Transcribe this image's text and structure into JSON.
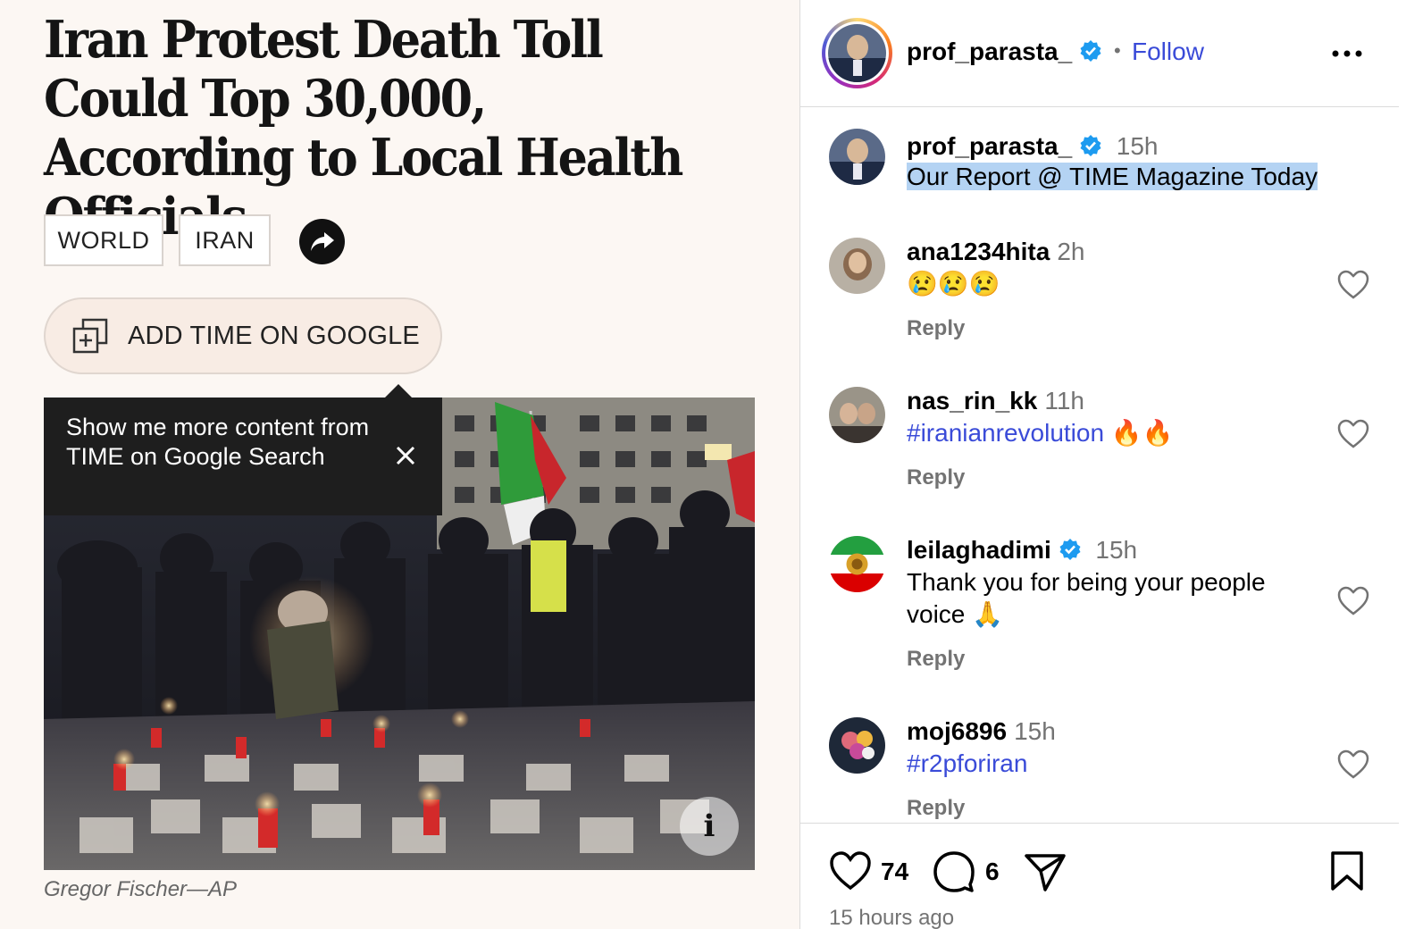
{
  "article": {
    "headline": "Iran Protest Death Toll Could Top 30,000, According to Local Health Officials",
    "tags": [
      "WORLD",
      "IRAN"
    ],
    "google_button_label": "ADD TIME ON GOOGLE",
    "tooltip_text": "Show me more content from TIME on Google Search",
    "info_label": "i",
    "photo_credit": "Gregor Fischer—AP"
  },
  "post": {
    "author": "prof_parasta_",
    "separator": "•",
    "follow_label": "Follow",
    "caption": {
      "username": "prof_parasta_",
      "time": "15h",
      "text": "Our Report @ TIME Magazine Today"
    },
    "comments": [
      {
        "username": "ana1234hita",
        "time": "2h",
        "text": "😢😢😢",
        "reply": "Reply"
      },
      {
        "username": "nas_rin_kk",
        "time": "11h",
        "text": "#iranianrevolution 🔥🔥",
        "reply": "Reply"
      },
      {
        "username": "leilaghadimi",
        "time": "15h",
        "text": "Thank you for being your people voice 🙏",
        "reply": "Reply"
      },
      {
        "username": "moj6896",
        "time": "15h",
        "text": "#r2pforiran",
        "reply": "Reply"
      }
    ],
    "likes": "74",
    "comment_count": "6",
    "timestamp": "15 hours ago"
  },
  "colors": {
    "link_blue": "#3a4bd8",
    "verified_blue": "#1d9bf0",
    "muted": "#737373",
    "selection": "#b4d3f3"
  },
  "icons": [
    "share-arrow-icon",
    "google-add-icon",
    "close-icon",
    "info-icon",
    "verified-icon",
    "more-options-icon",
    "heart-icon",
    "comment-icon",
    "send-icon",
    "bookmark-icon"
  ]
}
